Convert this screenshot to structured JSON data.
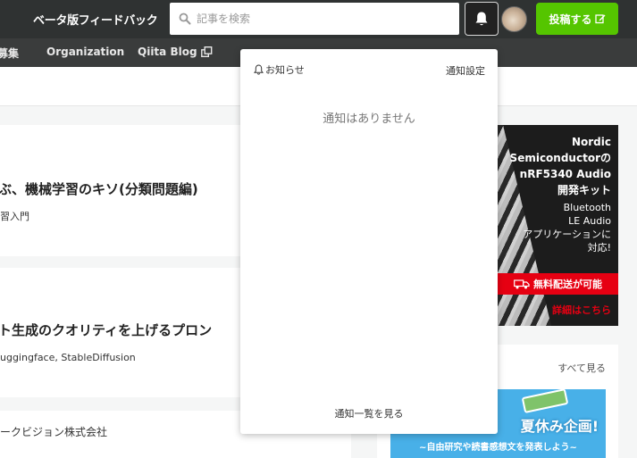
{
  "header": {
    "feedback_label": "ベータ版フィードバック",
    "search_placeholder": "記事を検索",
    "post_button_label": "投稿する",
    "brand_color": "#55c500"
  },
  "nav": {
    "items": [
      {
        "label": "募集"
      },
      {
        "label": "Organization"
      },
      {
        "label": "Qiita Blog"
      }
    ]
  },
  "articles": [
    {
      "title": "ぶ、機械学習のキソ(分類問題編)",
      "tags": "習入門"
    },
    {
      "title": "ト生成のクオリティを上げるプロン",
      "tags": "uggingface, StableDiffusion"
    },
    {
      "title": "ークビジョン株式会社",
      "tags": ""
    }
  ],
  "ad": {
    "headline_lines": [
      "Nordic",
      "Semiconductorの",
      "nRF5340 Audio",
      "開発キット"
    ],
    "body_lines": [
      "Bluetooth",
      "LE Audio",
      "アプリケーションに",
      "対応!"
    ],
    "shipping": "無料配送が可能",
    "details": "詳細はこちら"
  },
  "sidebar": {
    "see_all": "すべて見る",
    "banner_title": "夏休み企画!",
    "banner_sub": "~自由研究や読書感想文を発表しよう~"
  },
  "notifications": {
    "title": "お知らせ",
    "settings": "通知設定",
    "empty_message": "通知はありません",
    "view_all": "通知一覧を見る"
  }
}
